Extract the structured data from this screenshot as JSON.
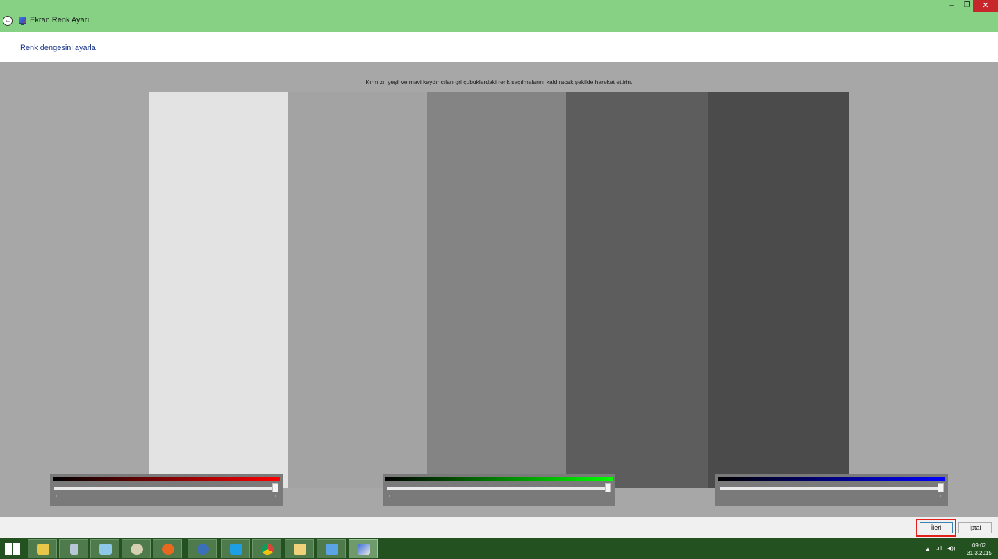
{
  "window": {
    "title": "Ekran Renk Ayarı",
    "back_glyph": "←",
    "min_glyph": "–",
    "max_glyph": "❐",
    "close_glyph": "✕",
    "titlebar_color": "#86d184"
  },
  "header": {
    "page_title": "Renk dengesini ayarla"
  },
  "main": {
    "instruction": "Kırmızı, yeşil ve mavi kaydırıcıları gri çubuklardaki renk saçılmalarını kaldıracak şekilde hareket ettirin.",
    "gray_bars": [
      "#e3e3e3",
      "#a3a3a3",
      "#848484",
      "#5d5d5d",
      "#4b4b4b"
    ],
    "sliders": [
      {
        "channel": "red",
        "color": "#ff0000",
        "value_fraction": 1.0
      },
      {
        "channel": "green",
        "color": "#00ff00",
        "value_fraction": 1.0
      },
      {
        "channel": "blue",
        "color": "#0000ff",
        "value_fraction": 1.0
      }
    ]
  },
  "footer": {
    "next_label": "İleri",
    "cancel_label": "İptal",
    "highlight_color": "#e3211c"
  },
  "taskbar": {
    "apps": [
      "windows-explorer-icon",
      "calculator-icon",
      "notepad-icon",
      "paint-icon",
      "firefox-icon",
      "thunderbird-icon",
      "skype-icon",
      "chrome-icon",
      "file-explorer-icon",
      "remote-desktop-icon",
      "color-calibration-icon"
    ],
    "clock_time": "09:02",
    "clock_date": "31.3.2015",
    "tray_arrow": "▲",
    "tray_signal": ".ıll",
    "tray_volume": "◀))"
  }
}
